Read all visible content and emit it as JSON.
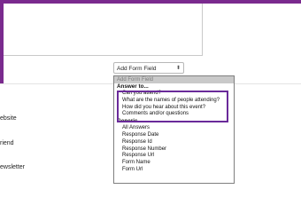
{
  "left_labels": {
    "website": "ebsite",
    "friend": "riend",
    "newsletter": "ewsletter"
  },
  "select": {
    "label": "Add Form Field",
    "chevron": "⬍"
  },
  "dropdown": {
    "selected": "Add Form Field",
    "groups": [
      {
        "label": "Answer to...",
        "options": [
          "Can you attend?",
          "What are the names of people attending?",
          "How did you hear about this event?",
          "Comments and/or questions"
        ]
      },
      {
        "label": "Generic",
        "options": [
          "All Answers",
          "Response Date",
          "Response Id",
          "Response Number",
          "Response Url",
          "Form Name",
          "Form Url"
        ]
      }
    ]
  },
  "colors": {
    "accent": "#7a2a8e",
    "highlight": "#6a2a9a"
  }
}
